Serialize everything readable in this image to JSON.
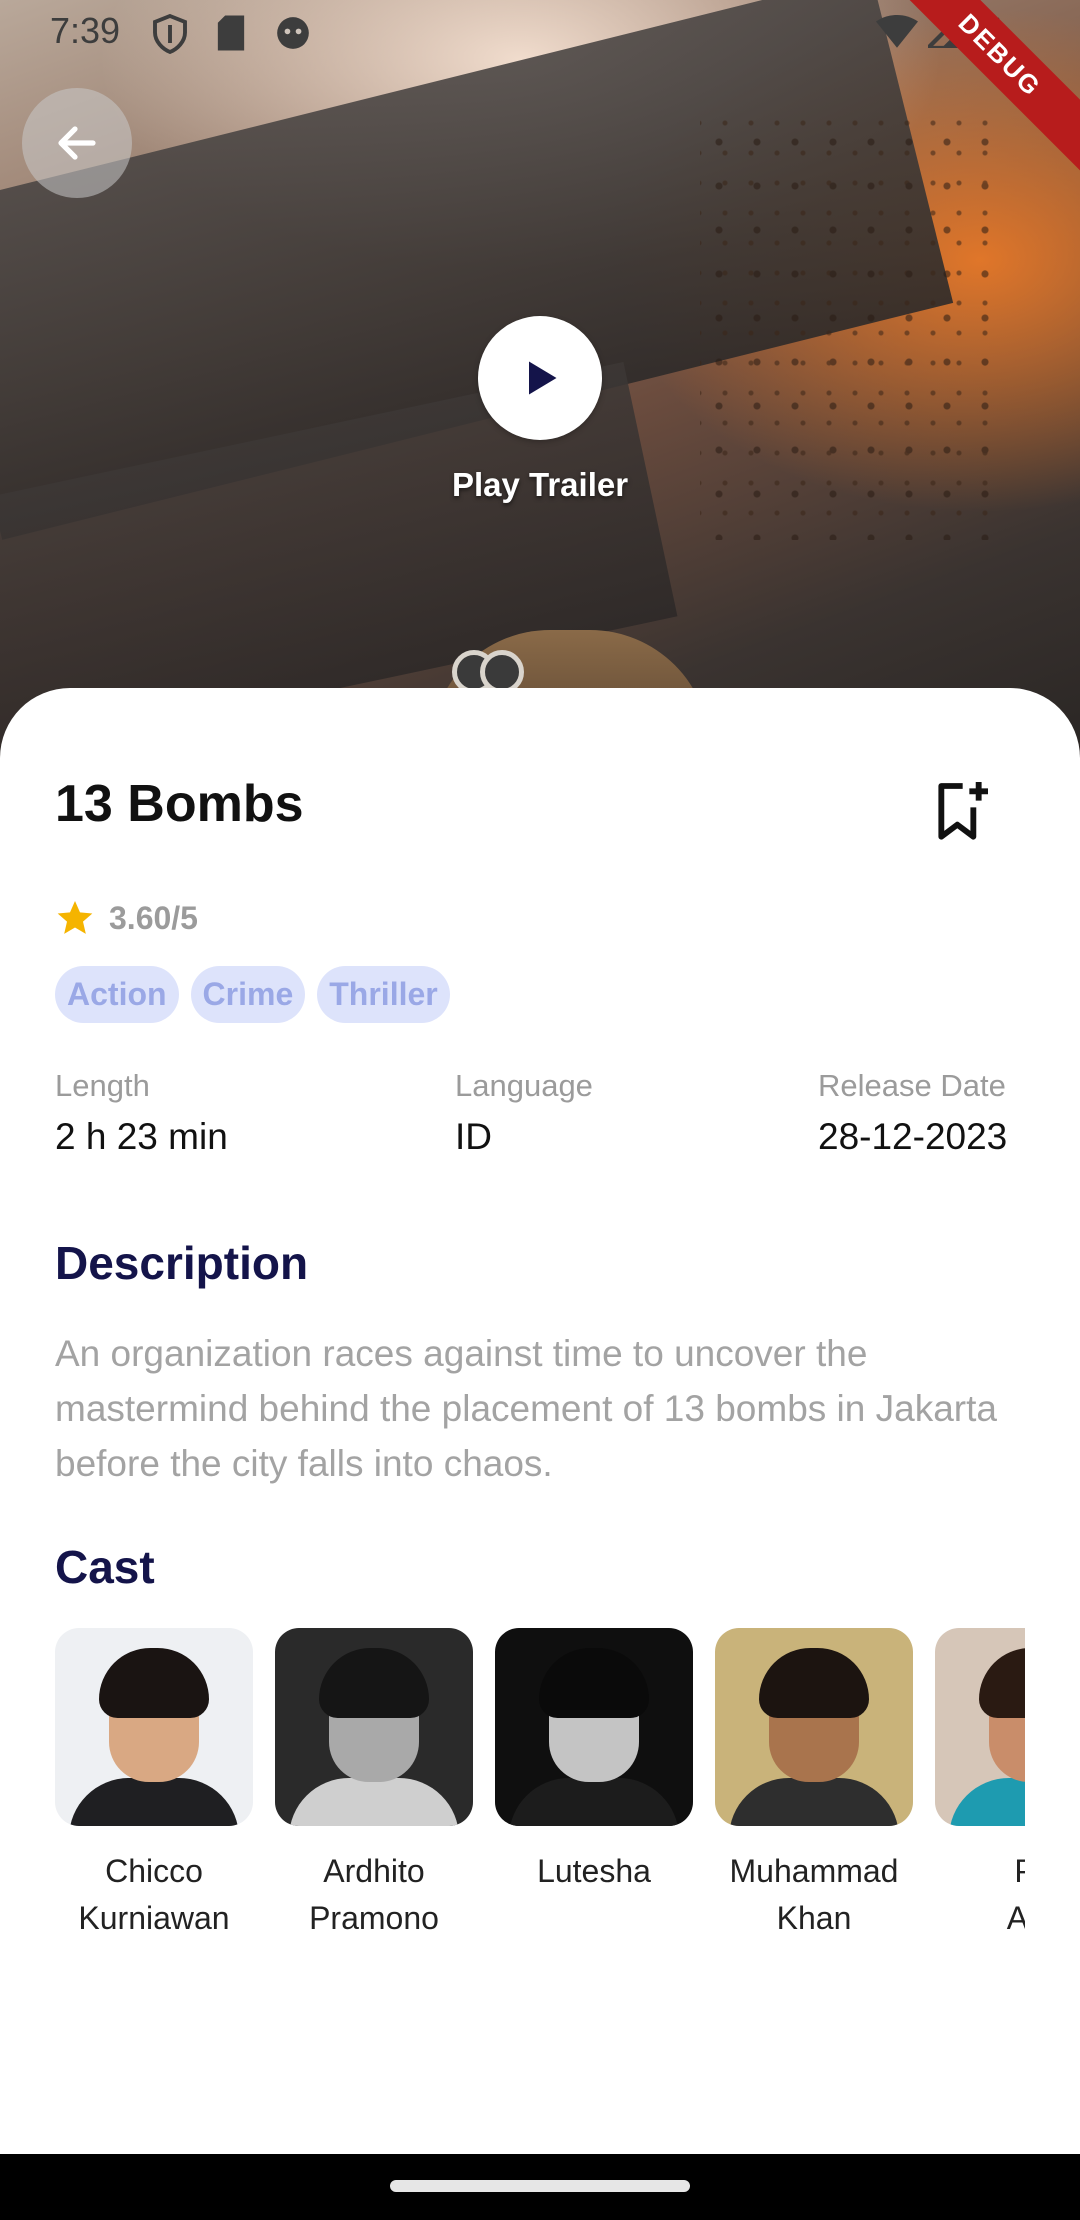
{
  "status_bar": {
    "time": "7:39",
    "debug_label": "DEBUG"
  },
  "hero": {
    "play_label": "Play Trailer"
  },
  "movie": {
    "title": "13 Bombs",
    "rating": "3.60/5",
    "genres": [
      "Action",
      "Crime",
      "Thriller"
    ],
    "info": [
      {
        "label": "Length",
        "value": "2 h 23 min"
      },
      {
        "label": "Language",
        "value": "ID"
      },
      {
        "label": "Release Date",
        "value": "28-12-2023"
      }
    ],
    "description_heading": "Description",
    "description": "An organization races against time to uncover the mastermind behind the placement of 13 bombs in Jakarta before the city falls into chaos.",
    "cast_heading": "Cast",
    "cast": [
      {
        "name": "Chicco\nKurniawan"
      },
      {
        "name": "Ardhito\nPramono"
      },
      {
        "name": "Lutesha"
      },
      {
        "name": "Muhammad\nKhan"
      },
      {
        "name": "Pu\nAyu"
      }
    ]
  },
  "colors": {
    "accent_dark": "#14144a",
    "chip_bg": "#dde3fb",
    "chip_text": "#9aa8e6",
    "star": "#f5b400"
  },
  "icons": [
    "back-arrow-icon",
    "play-icon",
    "bookmark-add-icon",
    "star-icon",
    "shield-icon",
    "sd-card-icon",
    "face-icon",
    "wifi-icon",
    "signal-icon",
    "battery-icon"
  ]
}
